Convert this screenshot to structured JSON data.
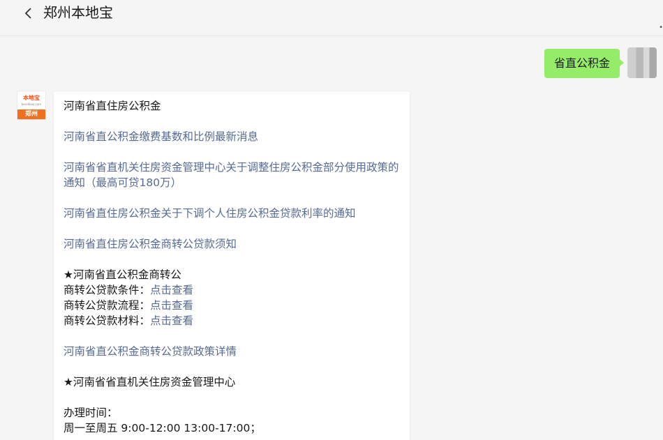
{
  "header": {
    "title": "郑州本地宝",
    "dot": "•"
  },
  "outgoing": {
    "text": "省直公积金"
  },
  "bot": {
    "logo_top": "本地宝",
    "logo_mid": "bendibao.com",
    "logo_bottom": "郑州"
  },
  "message": {
    "title": "河南省直住房公积金",
    "link1": "河南省直公积金缴费基数和比例最新消息",
    "link2": "河南省省直机关住房资金管理中心关于调整住房公积金部分使用政策的通知（最高可贷180万）",
    "link3": "河南省直住房公积金关于下调个人住房公积金贷款利率的通知",
    "link4": "河南省直住房公积金商转公贷款须知",
    "section1_title": "★河南省直公积金商转公",
    "rows": [
      {
        "label": "商转公贷款条件：",
        "link": "点击查看"
      },
      {
        "label": "商转公贷款流程：",
        "link": "点击查看"
      },
      {
        "label": "商转公贷款材料：",
        "link": "点击查看"
      }
    ],
    "link5": "河南省直公积金商转公贷款政策详情",
    "section2_title": "★河南省省直机关住房资金管理中心",
    "hours_label": "办理时间：",
    "hours_value": "周一至周五  9:00-12:00  13:00-17:00；"
  }
}
